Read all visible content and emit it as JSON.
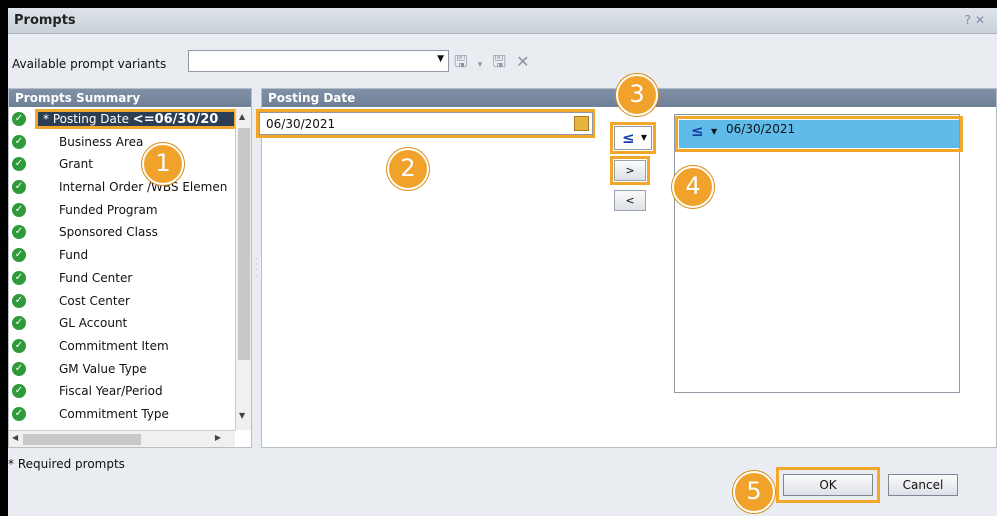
{
  "window": {
    "title": "Prompts",
    "help_icon": "help-icon",
    "close_icon": "close-icon"
  },
  "variants": {
    "label": "Available prompt variants",
    "value": ""
  },
  "summary": {
    "header": "Prompts Summary",
    "selected_item": {
      "prefix": "* Posting Date ",
      "condition": "<=06/30/20"
    },
    "items": [
      "Business Area",
      "Grant",
      "Internal Order /WBS Elemen",
      "Funded Program",
      "Sponsored Class",
      "Fund",
      "Fund Center",
      "Cost Center",
      "GL Account",
      "Commitment Item",
      "GM Value Type",
      "Fiscal Year/Period",
      "Commitment Type"
    ]
  },
  "posting": {
    "header": "Posting Date",
    "input_value": "06/30/2021",
    "operator": "≤",
    "add_label": ">",
    "remove_label": "<",
    "selected_operator": "≤",
    "selected_value": "06/30/2021"
  },
  "footer": {
    "required_note": "* Required prompts",
    "ok_label": "OK",
    "cancel_label": "Cancel"
  },
  "badges": [
    "1",
    "2",
    "3",
    "4",
    "5"
  ],
  "colors": {
    "highlight": "#f2a72a",
    "badge": "#f0a22a",
    "selected_row": "#5fbcea",
    "check": "#2f9a3a"
  }
}
